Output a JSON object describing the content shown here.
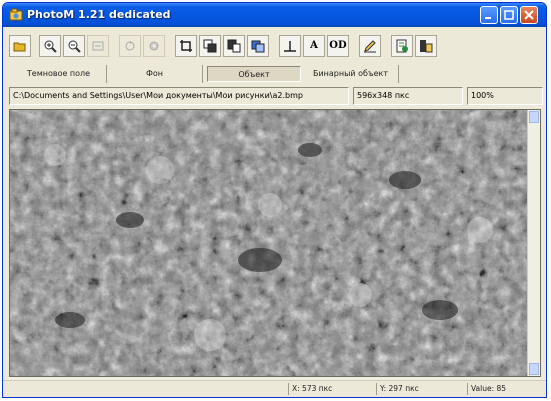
{
  "window": {
    "title": "PhotoM 1.21 dedicated",
    "accent": "#0558e0"
  },
  "toolbar": {
    "buttons": [
      {
        "name": "open-folder-icon"
      },
      {
        "name": "zoom-in-icon"
      },
      {
        "name": "zoom-out-icon"
      },
      {
        "name": "fit-window-icon"
      },
      {
        "name": "rotate-icon"
      },
      {
        "name": "settings-icon"
      },
      {
        "name": "crop-icon"
      },
      {
        "name": "copy-icon"
      },
      {
        "name": "paste-icon"
      },
      {
        "name": "duplicate-icon"
      },
      {
        "name": "measure-perpendicular-icon"
      },
      {
        "name": "text-icon",
        "glyph": "A"
      },
      {
        "name": "optical-density-icon",
        "glyph": "OD"
      },
      {
        "name": "pencil-icon"
      },
      {
        "name": "export-icon"
      },
      {
        "name": "info-icon"
      }
    ]
  },
  "tabs": [
    {
      "label": "Темновое поле"
    },
    {
      "label": "Фон"
    },
    {
      "label": "Объект",
      "active": true
    },
    {
      "label": "Бинарный объект"
    }
  ],
  "pathbar": {
    "path": "C:\\Documents and Settings\\User\\Мои документы\\Мои рисунки\\a2.bmp",
    "size": "596x348 пкс",
    "zoom": "100%"
  },
  "status": {
    "x": "X: 573 пкс",
    "y": "Y: 297 пкс",
    "value": "Value: 85"
  }
}
